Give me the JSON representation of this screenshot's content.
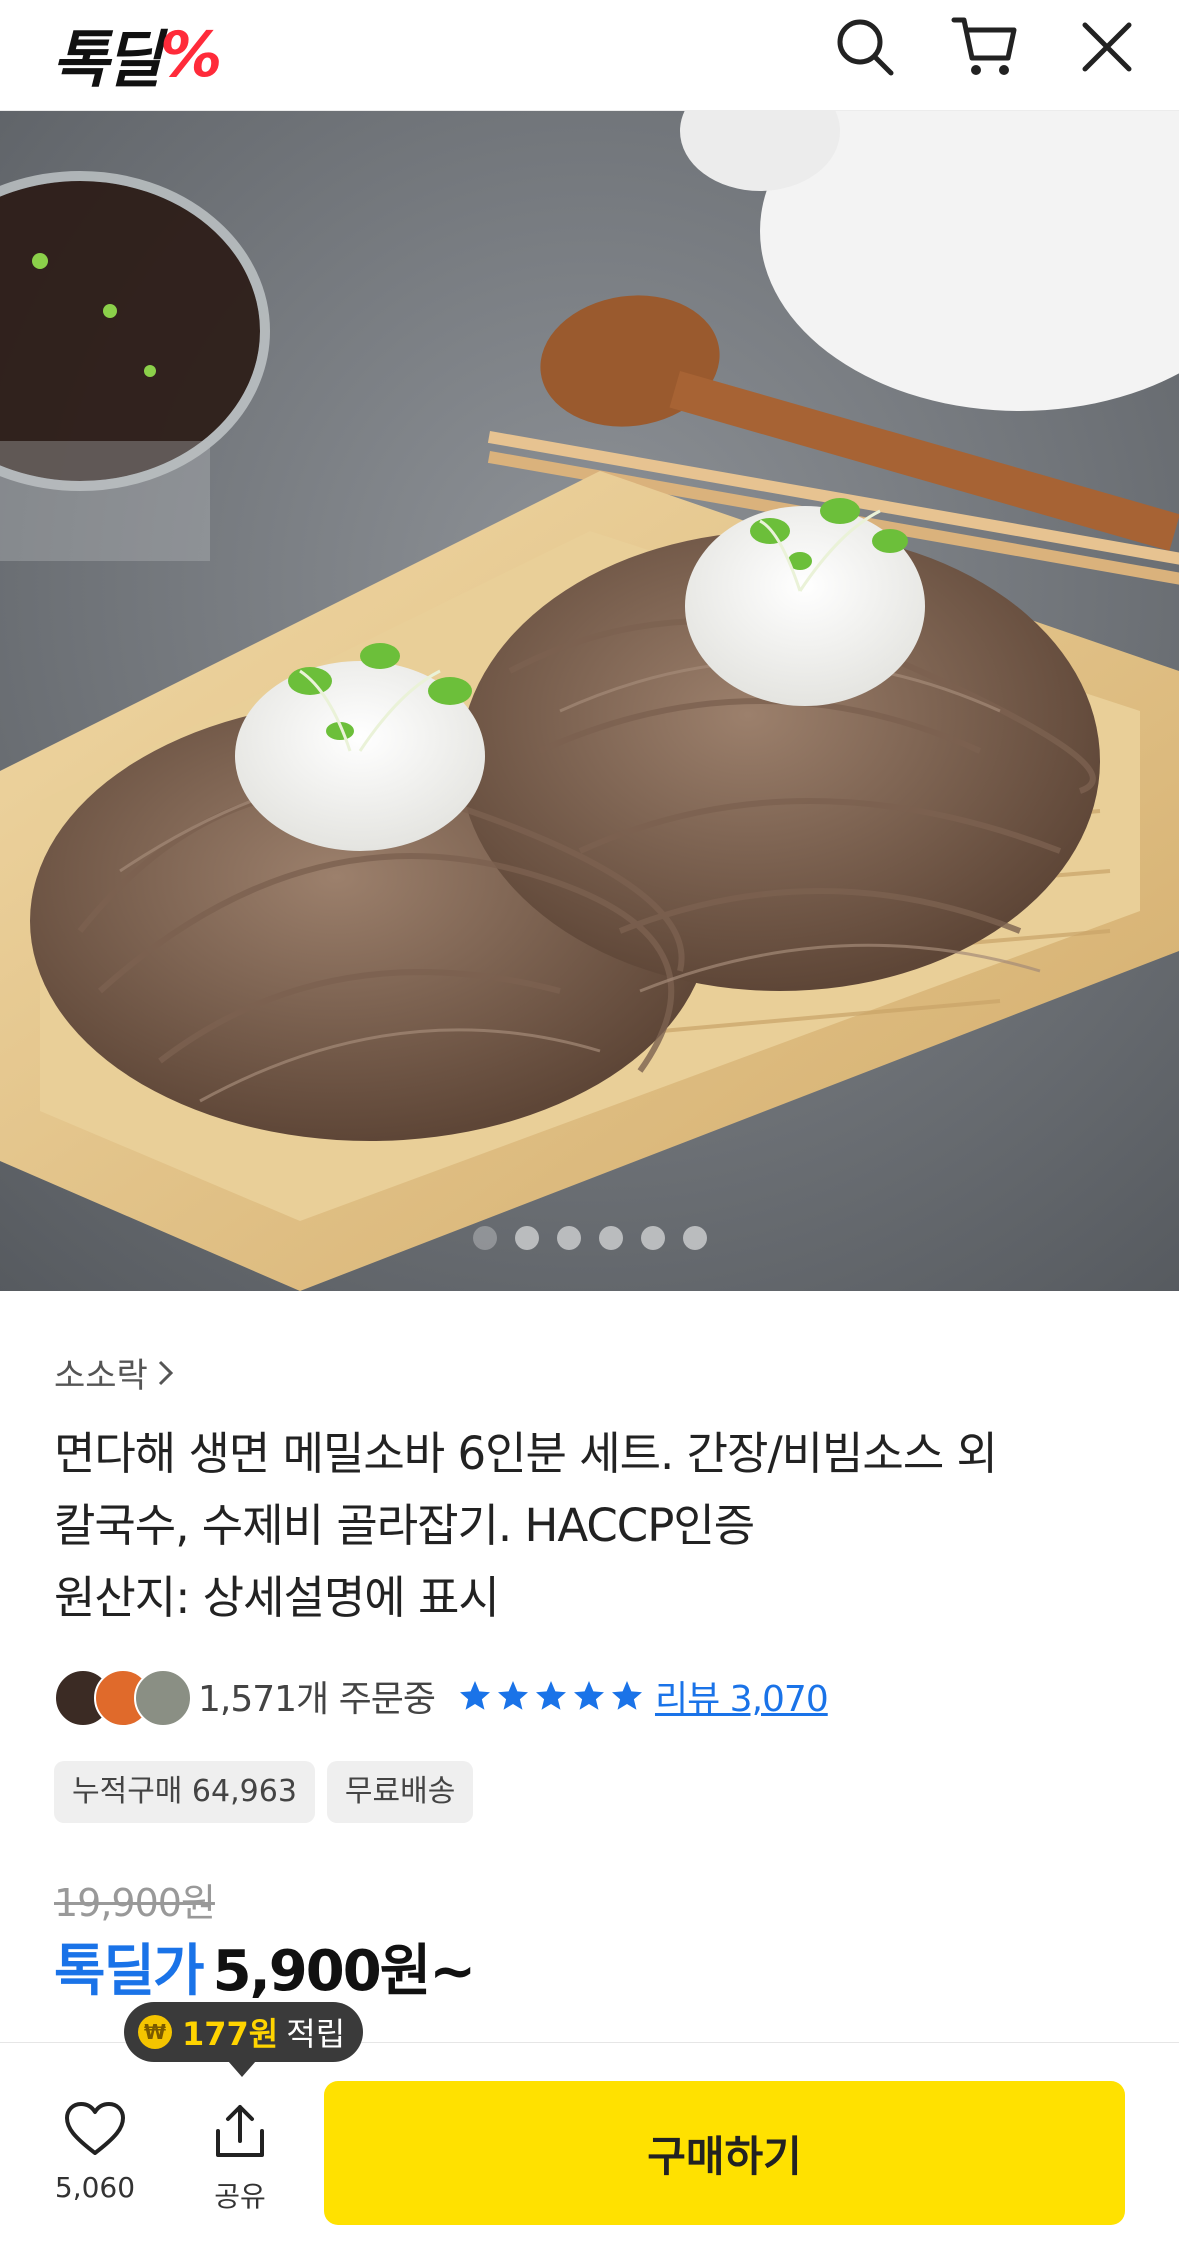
{
  "header": {
    "logo_text": "톡딜",
    "logo_symbol": "%",
    "logo_color": "#ff2b3a",
    "icons": [
      "search-icon",
      "cart-icon",
      "close-icon"
    ]
  },
  "hero": {
    "image_alt": "buckwheat soba noodles with grated radish on bamboo tray",
    "slide_count": 6,
    "active_slide": 1
  },
  "product": {
    "seller": "소소락",
    "title_lines": [
      "면다해 생면 메밀소바 6인분 세트. 간장/비빔소스 외",
      "칼국수, 수제비 골라잡기. HACCP인증",
      "원산지: 상세설명에 표시"
    ],
    "orders_text": "1,571개 주문중",
    "rating_stars": 5,
    "review_text": "리뷰 3,070",
    "tags": [
      "누적구매 64,963",
      "무료배송"
    ],
    "original_price": "19,900원",
    "price_label": "톡딜가",
    "price": "5,900원~",
    "points_amount": "177원",
    "points_suffix": "적립",
    "coin_symbol": "₩"
  },
  "bottom_bar": {
    "like_count": "5,060",
    "share_label": "공유",
    "buy_label": "구매하기",
    "buy_color": "#ffe100"
  },
  "colors": {
    "accent_blue": "#1a73e8",
    "star_blue": "#1a73e8"
  }
}
